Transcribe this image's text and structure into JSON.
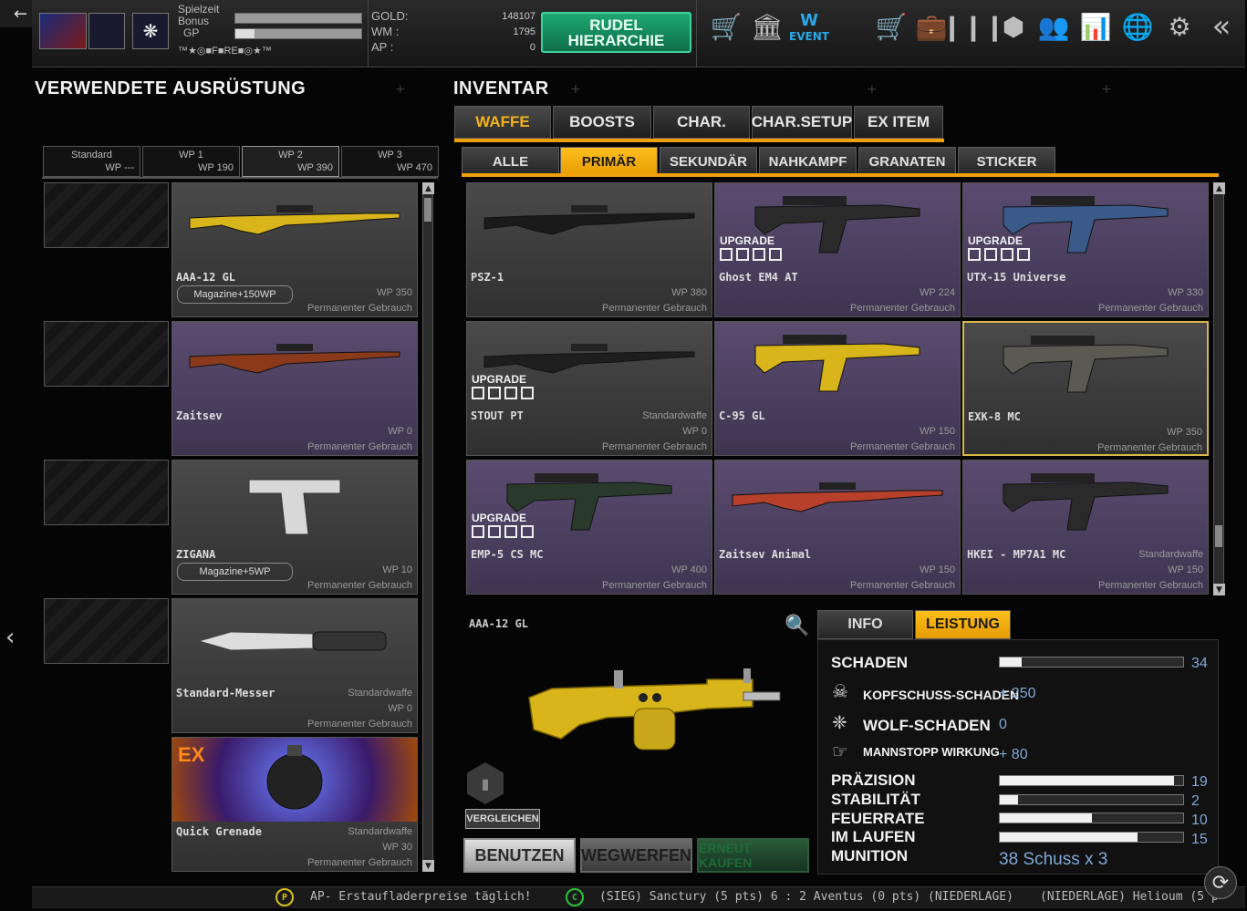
{
  "nav": {
    "back_icon": "arrow-left-icon",
    "side_icon": "chevron-left-icon"
  },
  "topbar": {
    "spielzeit_label": "Spielzeit",
    "bonus_label": "Bonus",
    "gp_label": "GP",
    "clan_tag": "™★◎■F■RE■◎★™",
    "currencies": [
      {
        "label": "GOLD:",
        "value": "148107",
        "unit": "G"
      },
      {
        "label": "WM :",
        "value": "1795",
        "unit": "WM"
      },
      {
        "label": "AP :",
        "value": "0",
        "unit": "AP"
      }
    ],
    "rudel_line1": "RUDEL",
    "rudel_line2": "HIERARCHIE",
    "event_label": "EVENT",
    "icons": [
      "basket-icon",
      "bank-icon",
      "event-icon",
      "cart-icon",
      "briefcase-icon",
      "bullets-icon",
      "box-icon",
      "friends-icon",
      "stats-icon",
      "globe-icon",
      "gear-icon",
      "collapse-icon"
    ]
  },
  "equipment": {
    "title": "VERWENDETE AUSRÜSTUNG",
    "presets": [
      {
        "name": "Standard",
        "wp": "WP ---"
      },
      {
        "name": "WP 1",
        "wp": "WP 190"
      },
      {
        "name": "WP 2",
        "wp": "WP 390"
      },
      {
        "name": "WP 3",
        "wp": "WP 470"
      }
    ],
    "items": [
      {
        "name": "AAA-12 GL",
        "magazine": "Magazine+150WP",
        "wp": "WP 350",
        "perm": "Permanenter Gebrauch"
      },
      {
        "name": "Zaitsev",
        "wp": "WP 0",
        "perm": "Permanenter Gebrauch"
      },
      {
        "name": "ZIGANA",
        "magazine": "Magazine+5WP",
        "wp": "WP 10",
        "perm": "Permanenter Gebrauch"
      },
      {
        "name": "Standard-Messer",
        "std": "Standardwaffe",
        "wp": "WP 0",
        "perm": "Permanenter Gebrauch"
      },
      {
        "name": "Quick Grenade",
        "ex": "EX",
        "std": "Standardwaffe",
        "wp": "WP 30",
        "perm": "Permanenter Gebrauch"
      }
    ]
  },
  "inventory": {
    "title": "INVENTAR",
    "tabs": [
      "WAFFE",
      "BOOSTS",
      "CHAR.",
      "CHAR.SETUP",
      "EX ITEM"
    ],
    "subtabs": [
      "ALLE",
      "PRIMÄR",
      "SEKUNDÄR",
      "NAHKAMPF",
      "GRANATEN",
      "STICKER"
    ],
    "upgrade_label": "UPGRADE",
    "items": [
      {
        "name": "PSZ-1",
        "wp": "WP 380",
        "perm": "Permanenter Gebrauch"
      },
      {
        "name": "Ghost EM4 AT",
        "upgrade": true,
        "wp": "WP 224",
        "perm": "Permanenter Gebrauch"
      },
      {
        "name": "UTX-15 Universe",
        "upgrade": true,
        "wp": "WP 330",
        "perm": "Permanenter Gebrauch"
      },
      {
        "name": "STOUT PT",
        "upgrade": true,
        "std": "Standardwaffe",
        "wp": "WP 0",
        "perm": "Permanenter Gebrauch"
      },
      {
        "name": "C-95 GL",
        "wp": "WP 150",
        "perm": "Permanenter Gebrauch"
      },
      {
        "name": "EXK-8 MC",
        "wp": "WP 350",
        "perm": "Permanenter Gebrauch"
      },
      {
        "name": "EMP-5 CS MC",
        "upgrade": true,
        "wp": "WP 400",
        "perm": "Permanenter Gebrauch"
      },
      {
        "name": "Zaitsev Animal",
        "wp": "WP 150",
        "perm": "Permanenter Gebrauch"
      },
      {
        "name": "HKEI - MP7A1 MC",
        "std": "Standardwaffe",
        "wp": "WP 150",
        "perm": "Permanenter Gebrauch"
      }
    ]
  },
  "detail": {
    "item_name": "AAA-12 GL",
    "compare_label": "VERGLEICHEN",
    "tabs": [
      "INFO",
      "LEISTUNG"
    ],
    "stats": {
      "schaden": {
        "label": "SCHADEN",
        "value": "34",
        "pct": 0.12
      },
      "kopf": {
        "label": "KOPFSCHUSS-SCHADEN",
        "value": "+ 250"
      },
      "wolf": {
        "label": "WOLF-SCHADEN",
        "value": "0"
      },
      "mann": {
        "label": "MANNSTOPP WIRKUNG",
        "value": "+ 80"
      },
      "praezision": {
        "label": "PRÄZISION",
        "value": "19",
        "pct": 0.95
      },
      "stabilitaet": {
        "label": "STABILITÄT",
        "value": "2",
        "pct": 0.1
      },
      "feuerrate": {
        "label": "FEUERRATE",
        "value": "10",
        "pct": 0.5
      },
      "laufen": {
        "label": "IM LAUFEN",
        "value": "15",
        "pct": 0.75
      },
      "munition": {
        "label": "MUNITION",
        "value": "38 Schuss x 3"
      }
    },
    "buttons": {
      "use": "BENUTZEN",
      "discard": "WEGWERFEN",
      "rebuy": "ERNEUT KAUFEN"
    }
  },
  "ticker": {
    "msg1": "AP- Erstaufladerpreise täglich!",
    "msg2": "(SIEG) Sanctury (5 pts) 6 : 2 Aventus (0 pts) (NIEDERLAGE)",
    "msg3": "(NIEDERLAGE) Helioum (5 p"
  },
  "colors": {
    "accent": "#f0a00c",
    "rudel": "#1ea872",
    "stat_value": "#7fa8d8"
  }
}
